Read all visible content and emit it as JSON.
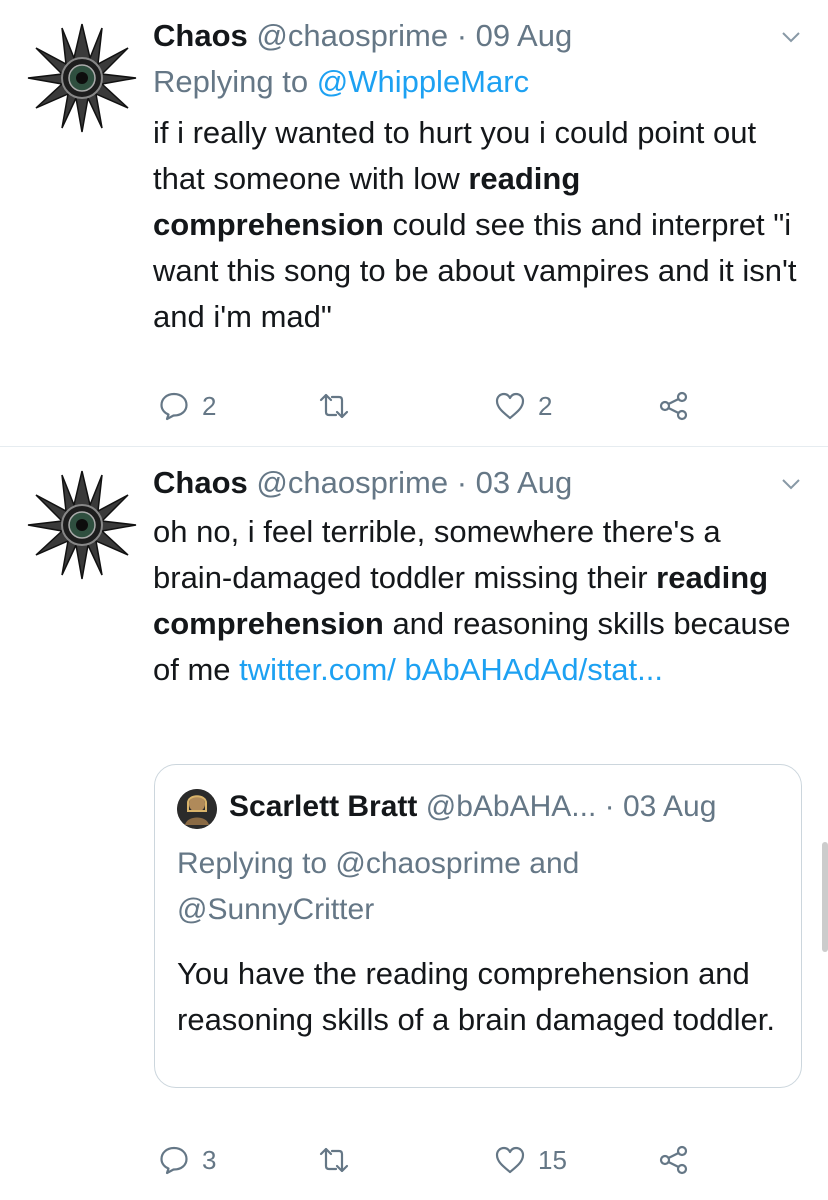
{
  "tweets": [
    {
      "author": {
        "name": "Chaos",
        "handle": "@chaosprime"
      },
      "separator": "·",
      "date": "09 Aug",
      "replying_prefix": "Replying to ",
      "replying_to": "@WhippleMarc",
      "body": {
        "pre": "if i really wanted to hurt you i could point out that someone with low ",
        "bold": "reading comprehension",
        "post": " could see this and interpret \"i want this song to be about vampires and it isn't and i'm mad\""
      },
      "actions": {
        "replies": "2",
        "retweets": "",
        "likes": "2"
      }
    },
    {
      "author": {
        "name": "Chaos",
        "handle": "@chaosprime"
      },
      "separator": "·",
      "date": "03 Aug",
      "body": {
        "pre": "oh no, i feel terrible, somewhere there's a brain-damaged toddler missing their ",
        "bold": "reading comprehension",
        "mid": " and reasoning skills because of me ",
        "link": "twitter.com/ bAbAHAdAd/stat..."
      },
      "quote": {
        "name": "Scarlett Bratt",
        "handle": "@bAbAHA...",
        "separator": "·",
        "date": "03 Aug",
        "replying": "Replying to @chaosprime and @SunnyCritter",
        "body": "You have the reading comprehension and reasoning skills of a brain damaged toddler."
      },
      "actions": {
        "replies": "3",
        "retweets": "",
        "likes": "15"
      }
    }
  ],
  "icons": [
    "chaos-star-avatar-icon",
    "chevron-down-icon",
    "reply-icon",
    "retweet-icon",
    "heart-icon",
    "share-icon"
  ],
  "colors": {
    "link": "#1da1f2",
    "muted": "#657786",
    "text": "#14171a",
    "divider": "#e6ecf0"
  }
}
